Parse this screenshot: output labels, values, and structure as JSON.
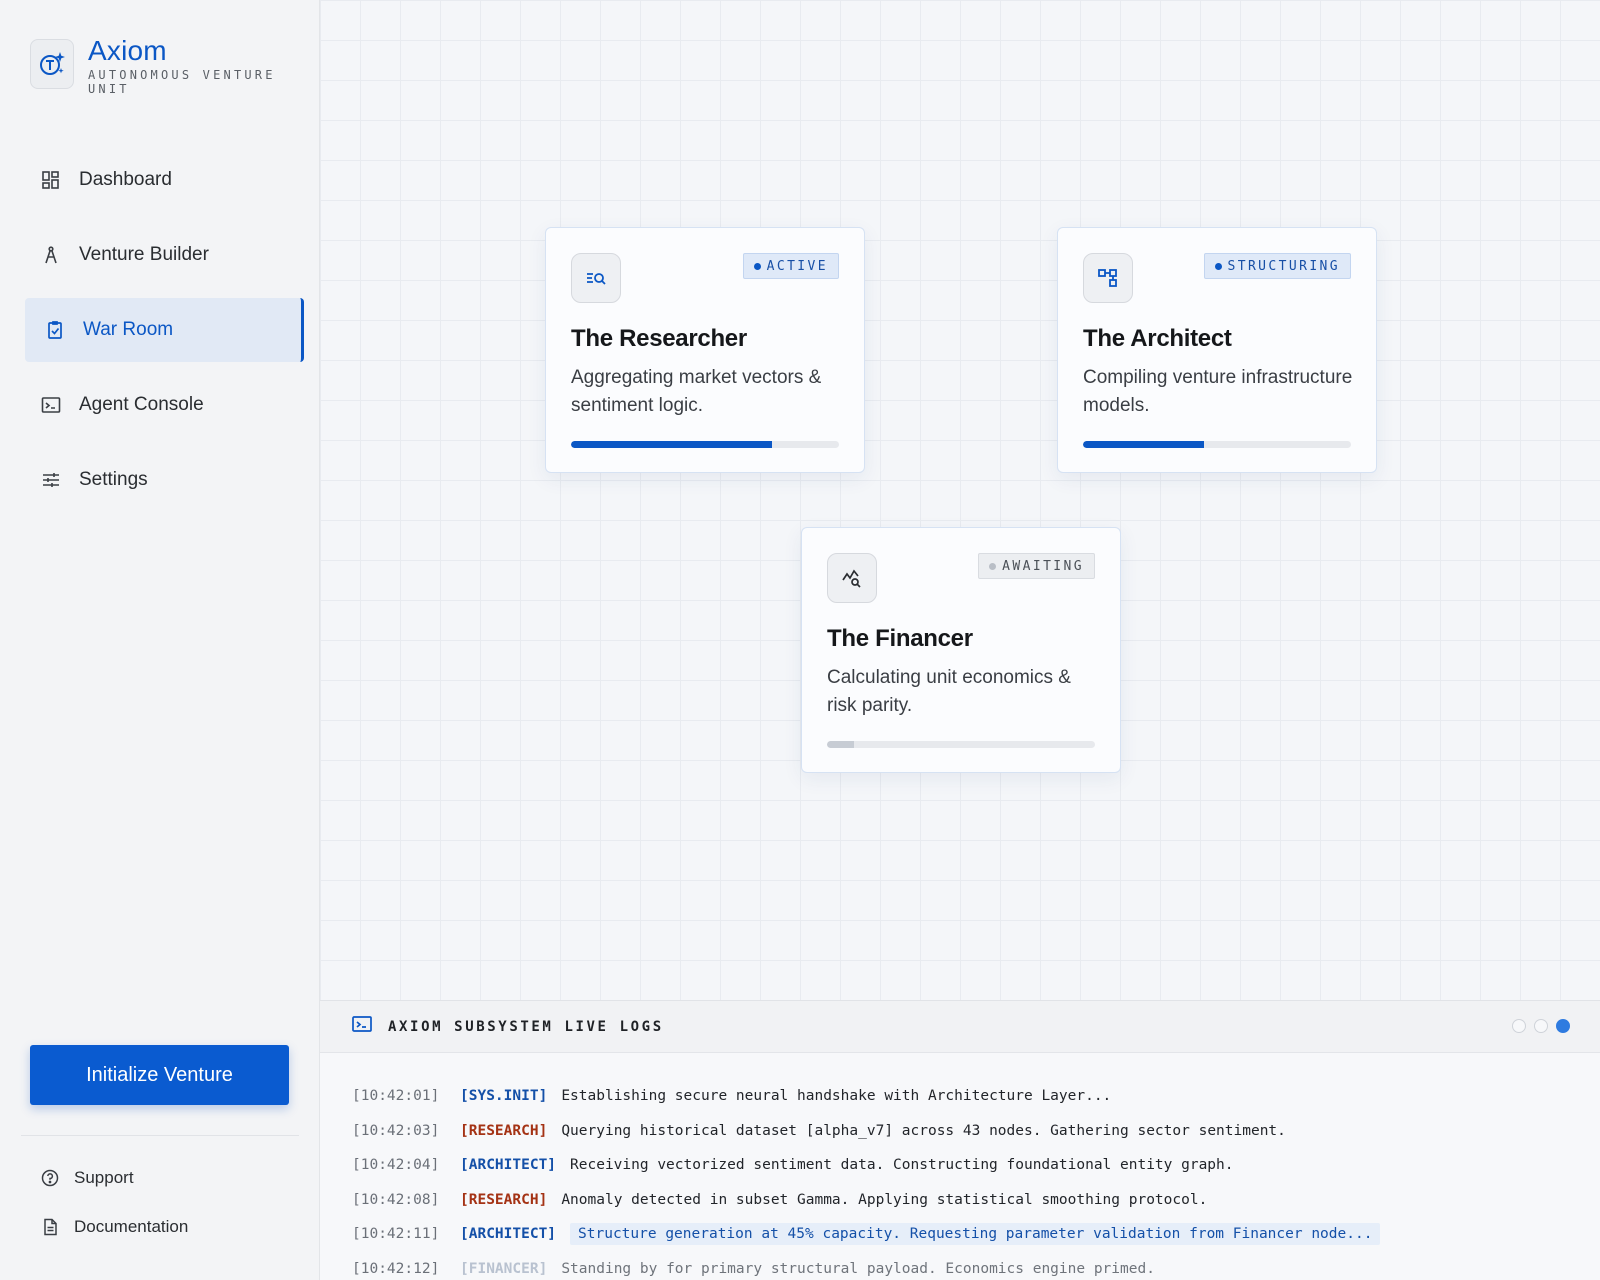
{
  "brand": {
    "name": "Axiom",
    "subtitle": "AUTONOMOUS VENTURE UNIT",
    "logo_icon": "spark-logo-icon"
  },
  "nav": [
    {
      "label": "Dashboard",
      "icon": "dashboard-icon"
    },
    {
      "label": "Venture Builder",
      "icon": "compass-icon"
    },
    {
      "label": "War Room",
      "icon": "clipboard-check-icon",
      "active": true
    },
    {
      "label": "Agent Console",
      "icon": "terminal-icon"
    },
    {
      "label": "Settings",
      "icon": "sliders-icon"
    }
  ],
  "cta": {
    "label": "Initialize Venture"
  },
  "footer": {
    "support": "Support",
    "documentation": "Documentation"
  },
  "agents": [
    {
      "title": "The Researcher",
      "status": "ACTIVE",
      "desc": "Aggregating market vectors & sentiment logic.",
      "progress": 0.75,
      "icon": "search-list-icon",
      "accent": "#0b57c5"
    },
    {
      "title": "The Architect",
      "status": "STRUCTURING",
      "desc": "Compiling venture infrastructure models.",
      "progress": 0.45,
      "icon": "hierarchy-icon",
      "accent": "#0b57c5"
    },
    {
      "title": "The Financer",
      "status": "AWAITING",
      "desc": "Calculating unit economics & risk parity.",
      "progress": 0.1,
      "icon": "chart-search-icon",
      "accent": "#c7ccd4"
    }
  ],
  "logs": {
    "title": "AXIOM SUBSYSTEM LIVE LOGS",
    "lines": [
      {
        "time": "[10:42:01]",
        "tag": "[SYS.INIT]",
        "msg": "Establishing secure neural handshake with Architecture Layer..."
      },
      {
        "time": "[10:42:03]",
        "tag": "[RESEARCH]",
        "msg": "Querying historical dataset [alpha_v7] across 43 nodes. Gathering sector sentiment."
      },
      {
        "time": "[10:42:04]",
        "tag": "[ARCHITECT]",
        "msg": "Receiving vectorized sentiment data. Constructing foundational entity graph."
      },
      {
        "time": "[10:42:08]",
        "tag": "[RESEARCH]",
        "msg": "Anomaly detected in subset Gamma. Applying statistical smoothing protocol."
      },
      {
        "time": "[10:42:11]",
        "tag": "[ARCHITECT]",
        "msg": "Structure generation at 45% capacity. Requesting parameter validation from Financer node..."
      },
      {
        "time": "[10:42:12]",
        "tag": "[FINANCER]",
        "msg": "Standing by for primary structural payload. Economics engine primed."
      }
    ]
  },
  "colors": {
    "primary": "#0b57c5",
    "research_tag": "#a43214",
    "financer_tag": "#b9c2d0"
  }
}
